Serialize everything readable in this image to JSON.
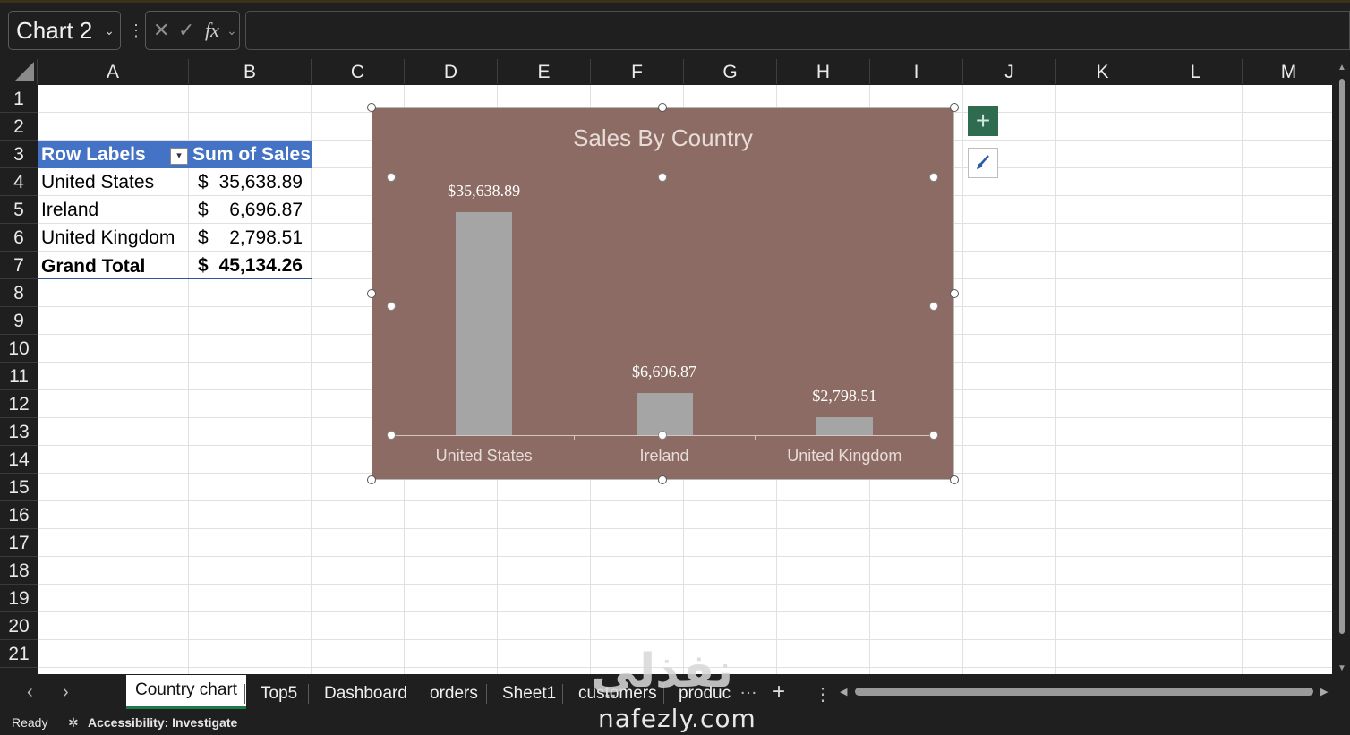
{
  "formula_bar": {
    "name_box": "Chart 2",
    "cancel_icon": "✕",
    "enter_icon": "✓",
    "fx_label": "fx",
    "formula": ""
  },
  "columns": [
    "A",
    "B",
    "C",
    "D",
    "E",
    "F",
    "G",
    "H",
    "I",
    "J",
    "K",
    "L",
    "M"
  ],
  "rows": [
    "1",
    "2",
    "3",
    "4",
    "5",
    "6",
    "7",
    "8",
    "9",
    "10",
    "11",
    "12",
    "13",
    "14",
    "15",
    "16",
    "17",
    "18",
    "19",
    "20",
    "21"
  ],
  "pivot": {
    "header_row_labels": "Row Labels",
    "header_sum": "Sum of Sales",
    "rows": [
      {
        "label": "United States",
        "currency": "$",
        "value": "35,638.89"
      },
      {
        "label": "Ireland",
        "currency": "$",
        "value": "6,696.87"
      },
      {
        "label": "United Kingdom",
        "currency": "$",
        "value": "2,798.51"
      }
    ],
    "total": {
      "label": "Grand Total",
      "currency": "$",
      "value": "45,134.26"
    }
  },
  "chart_data": {
    "type": "bar",
    "title": "Sales By Country",
    "categories": [
      "United States",
      "Ireland",
      "United Kingdom"
    ],
    "values": [
      35638.89,
      6696.87,
      2798.51
    ],
    "data_labels": [
      "$35,638.89",
      "$6,696.87",
      "$2,798.51"
    ],
    "xlabel": "",
    "ylabel": "",
    "ylim": [
      0,
      40000
    ],
    "grid": false,
    "legend": "none",
    "colors": {
      "background": "#8b6b63",
      "bar": "#a5a5a5"
    }
  },
  "chart_buttons": {
    "add_element_icon": "+",
    "style_icon": "brush-icon"
  },
  "sheet_tabs": [
    "Country chart",
    "Top5",
    "Dashboard",
    "orders",
    "Sheet1",
    "customers",
    "produc"
  ],
  "active_tab": "Country chart",
  "tab_controls": {
    "prev": "‹",
    "next": "›",
    "more": "…",
    "add": "+",
    "options": "⋮"
  },
  "status": {
    "ready": "Ready",
    "accessibility": "Accessibility: Investigate"
  },
  "watermark": {
    "arabic": "نفذلي",
    "domain": "nafezly.com"
  }
}
